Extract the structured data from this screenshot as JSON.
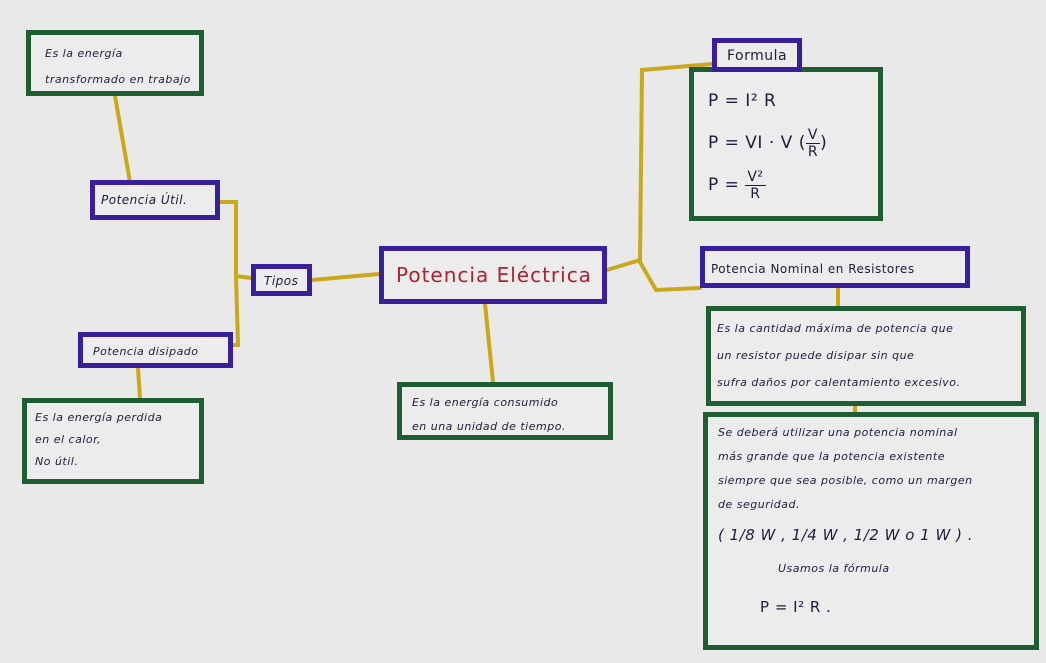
{
  "central": {
    "title": "Potencia Eléctrica"
  },
  "central_definition": [
    "Es la energía consumido",
    "en una unidad de tiempo."
  ],
  "tipos": {
    "label": "Tipos"
  },
  "potencia_util": {
    "label": "Potencia Útil.",
    "definition": [
      "Es la energía",
      "transformado en trabajo"
    ]
  },
  "potencia_disipada": {
    "label": "Potencia disipado",
    "definition": [
      "Es la energía perdida",
      "en el calor,",
      "No útil."
    ]
  },
  "formula": {
    "title": "Formula",
    "lines": [
      "P = I² R",
      "P = VI · V",
      "P ="
    ],
    "v_over_r": {
      "num": "V",
      "den": "R"
    },
    "v2_over_r": {
      "num": "V²",
      "den": "R"
    }
  },
  "potencia_nominal": {
    "label": "Potencia Nominal en Resistores",
    "definition": [
      "Es la cantidad máxima de potencia que",
      "un resistor puede disipar sin que",
      "sufra daños por calentamiento excesivo."
    ],
    "usage": [
      "Se deberá utilizar una potencia nominal",
      "más grande que la potencia existente",
      "siempre que sea posible, como un margen",
      "de seguridad."
    ],
    "values": "( 1/8 W ,  1/4 W ,  1/2 W  o  1 W ) .",
    "usamos": "Usamos la fórmula",
    "final_formula": "P = I² R ."
  },
  "colors": {
    "green_border": "#1f5e32",
    "blue_border": "#3a1f9a",
    "link": "#c9a81a",
    "title_red": "#b02030"
  }
}
